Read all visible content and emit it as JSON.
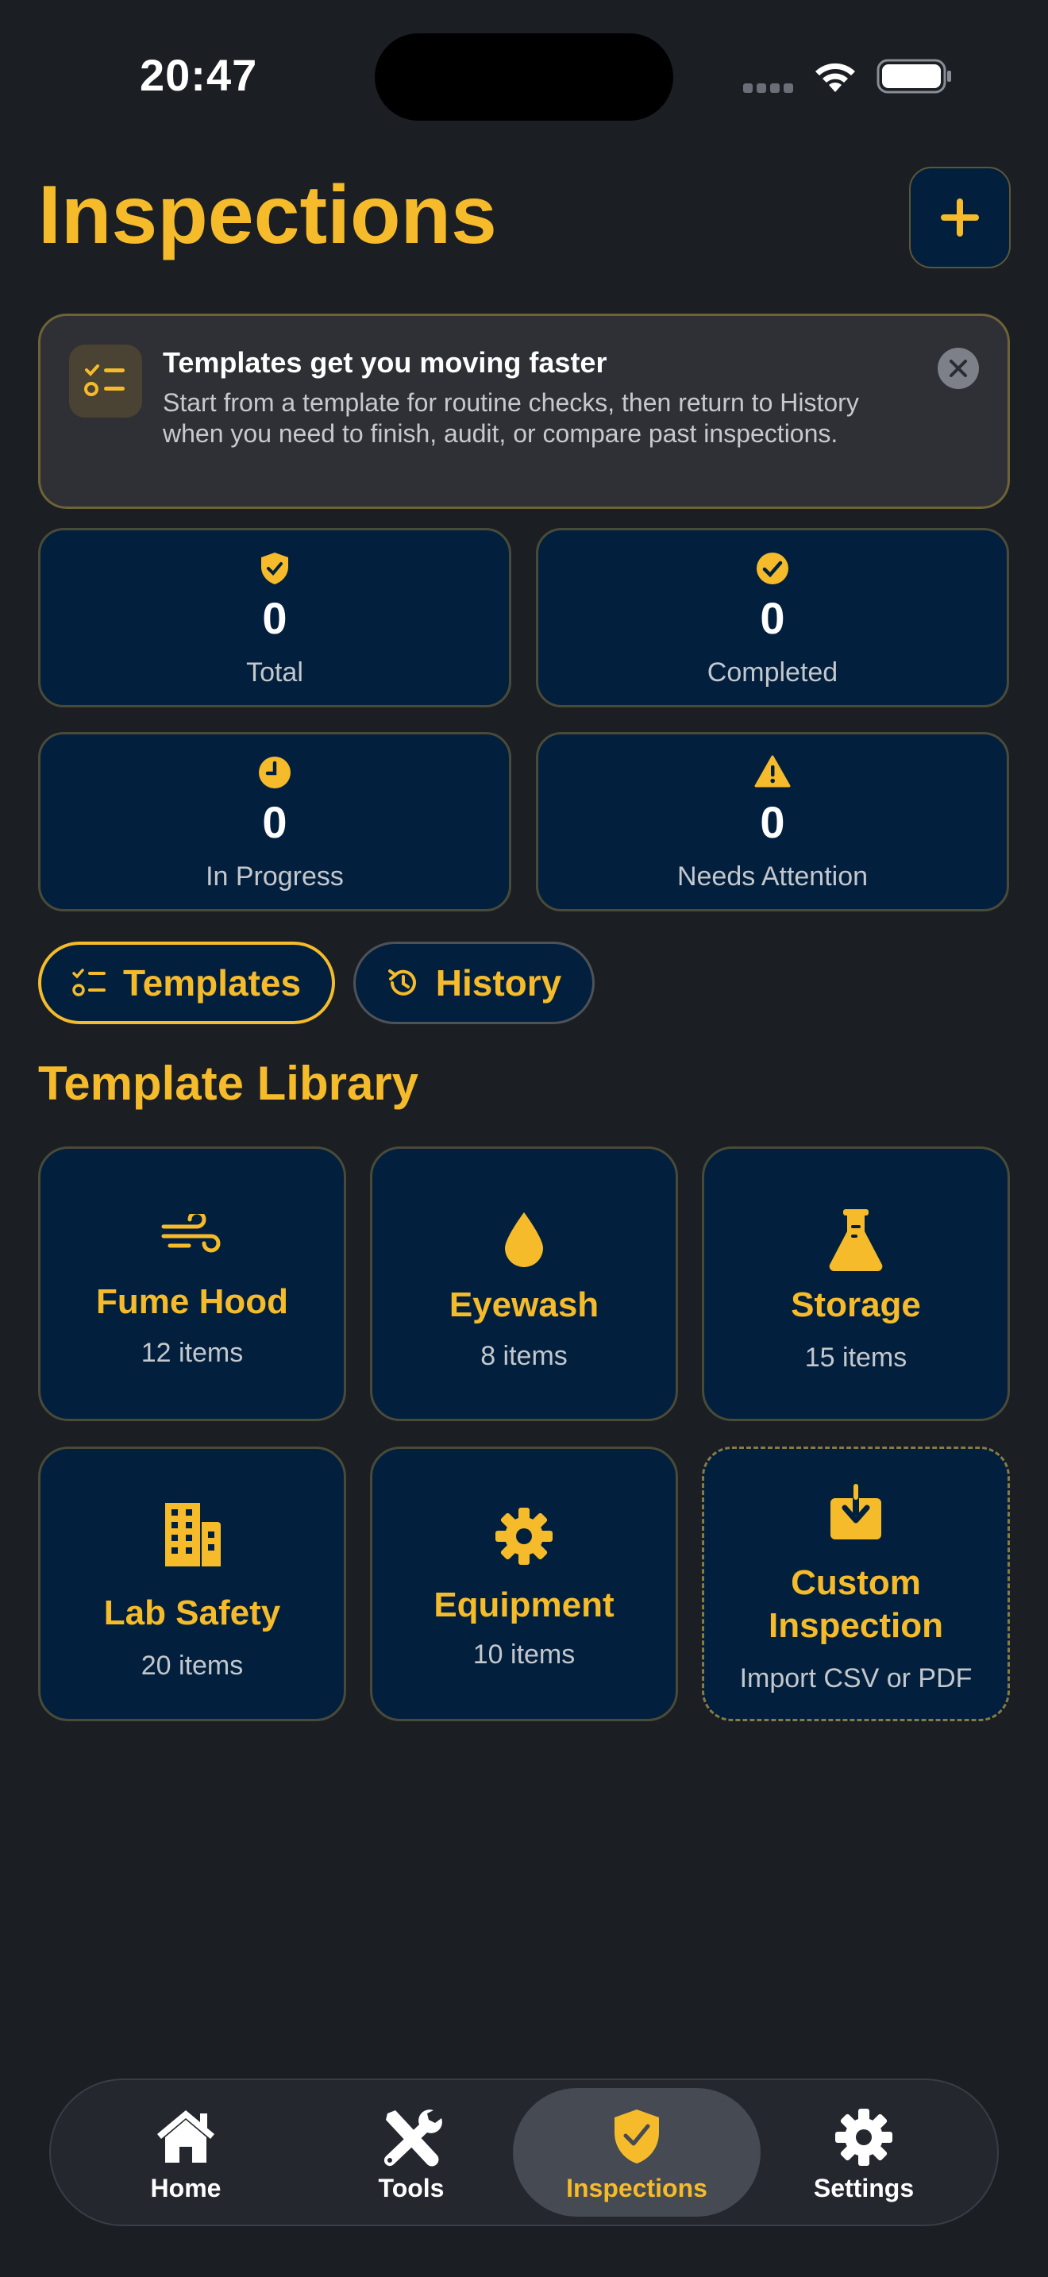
{
  "status_bar": {
    "time": "20:47"
  },
  "header": {
    "title": "Inspections",
    "add_icon": "plus-icon"
  },
  "tip": {
    "icon": "checklist-icon",
    "title": "Templates get you moving faster",
    "body": "Start from a template for routine checks, then return to History when you need to finish, audit, or compare past inspections.",
    "close_icon": "close-icon"
  },
  "stats": [
    {
      "icon": "shield-check-icon",
      "value": "0",
      "label": "Total"
    },
    {
      "icon": "check-circle-icon",
      "value": "0",
      "label": "Completed"
    },
    {
      "icon": "clock-icon",
      "value": "0",
      "label": "In Progress"
    },
    {
      "icon": "warning-icon",
      "value": "0",
      "label": "Needs Attention"
    }
  ],
  "tabs": [
    {
      "label": "Templates",
      "icon": "checklist-icon",
      "active": true
    },
    {
      "label": "History",
      "icon": "history-icon",
      "active": false
    }
  ],
  "library": {
    "title": "Template Library",
    "templates": [
      {
        "name": "Fume Hood",
        "count": "12 items",
        "icon": "wind-icon"
      },
      {
        "name": "Eyewash",
        "count": "8 items",
        "icon": "drop-icon"
      },
      {
        "name": "Storage",
        "count": "15 items",
        "icon": "flask-icon"
      },
      {
        "name": "Lab Safety",
        "count": "20 items",
        "icon": "building-icon"
      },
      {
        "name": "Equipment",
        "count": "10 items",
        "icon": "gear-icon"
      },
      {
        "name": "Custom\nInspection",
        "count": "Import CSV or PDF",
        "icon": "import-icon"
      }
    ]
  },
  "nav": [
    {
      "label": "Home",
      "icon": "home-icon",
      "active": false
    },
    {
      "label": "Tools",
      "icon": "tools-icon",
      "active": false
    },
    {
      "label": "Inspections",
      "icon": "shield-check-icon",
      "active": true
    },
    {
      "label": "Settings",
      "icon": "gear-icon",
      "active": false
    }
  ],
  "colors": {
    "accent": "#f5bb2a",
    "background": "#1b1e23",
    "card": "#02203d"
  }
}
